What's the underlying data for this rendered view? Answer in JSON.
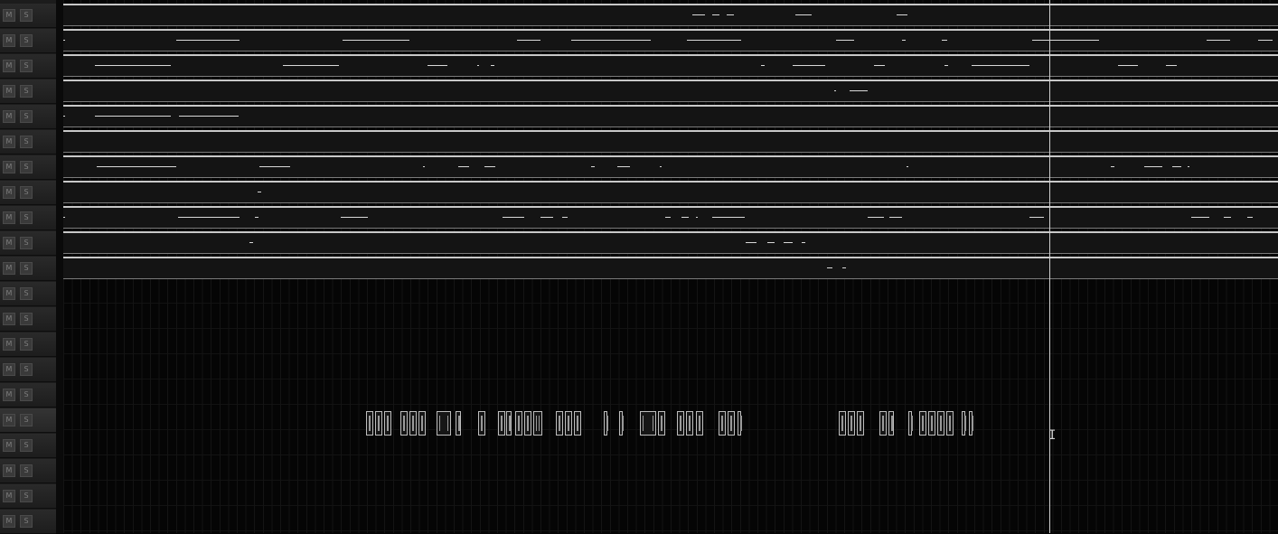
{
  "header_labels": {
    "mute": "M",
    "solo": "S"
  },
  "track_count": 21,
  "selected_track": 16,
  "midi_track_count": 11,
  "cursor_glyph": "I",
  "colors": {
    "background": "#050505",
    "clip_body": "#141414",
    "clip_border": "#c8c8c8",
    "note": "#d8d8d8",
    "playhead": "#cfcfcf"
  }
}
